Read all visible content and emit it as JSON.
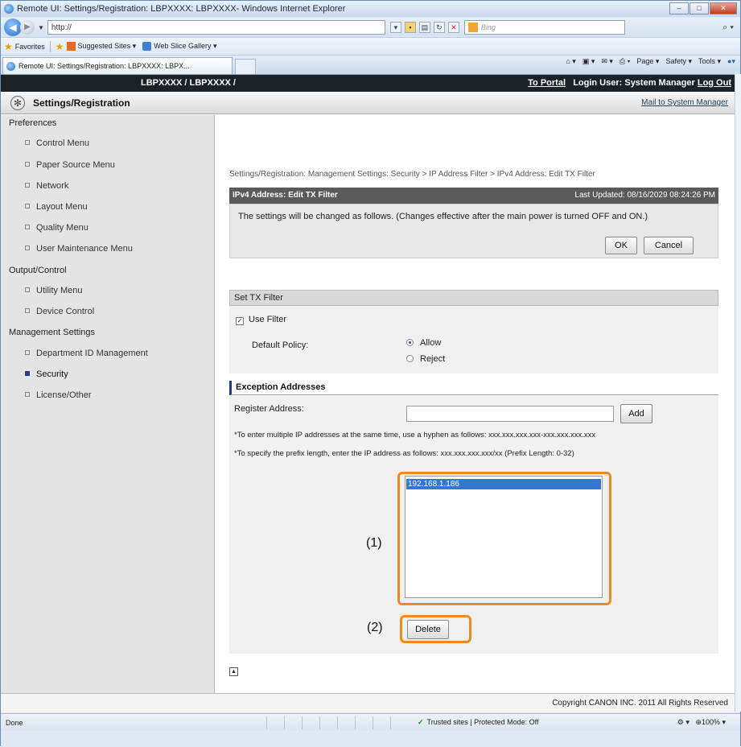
{
  "window": {
    "title": "Remote UI: Settings/Registration: LBPXXXX: LBPXXXX- Windows Internet Explorer"
  },
  "browser": {
    "url": "http://",
    "search_placeholder": "Bing",
    "favorites": {
      "label": "Favorites",
      "items": [
        "Suggested Sites ▾",
        "Web Slice Gallery ▾"
      ]
    },
    "tab_title": "Remote UI: Settings/Registration: LBPXXXX: LBPX...",
    "commands": [
      "Page ▾",
      "Safety ▾",
      "Tools ▾"
    ],
    "status": {
      "left": "Done",
      "zone": "Trusted sites | Protected Mode: Off",
      "zoom": "100%"
    }
  },
  "header": {
    "brand": "LBPXXXX / LBPXXXX /",
    "to_portal": "To Portal",
    "login_label": "Login User: System Manager",
    "logout": "Log Out",
    "page_title": "Settings/Registration",
    "mail_link": "Mail to System Manager"
  },
  "sidebar": {
    "preferences": "Preferences",
    "pref_items": [
      "Control Menu",
      "Paper Source Menu",
      "Network",
      "Layout Menu",
      "Quality Menu",
      "User Maintenance Menu"
    ],
    "output": "Output/Control",
    "output_items": [
      "Utility Menu",
      "Device Control"
    ],
    "management": "Management Settings",
    "mgmt_items": [
      "Department ID Management",
      "Security",
      "License/Other"
    ]
  },
  "main": {
    "breadcrumb": "Settings/Registration: Management Settings: Security > IP Address Filter > IPv4 Address: Edit TX Filter",
    "section_title": "IPv4 Address: Edit TX Filter",
    "last_updated": "Last Updated: 08/16/2029 08:24:26 PM",
    "message": "The settings will be changed as follows. (Changes effective after the main power is turned OFF and ON.)",
    "ok": "OK",
    "cancel": "Cancel",
    "set_tx_filter": "Set TX Filter",
    "use_filter": "Use Filter",
    "default_policy": "Default Policy:",
    "allow": "Allow",
    "reject": "Reject",
    "exception_addresses": "Exception Addresses",
    "register_address": "Register Address:",
    "add": "Add",
    "note1": "*To enter multiple IP addresses at the same time, use a hyphen as follows: xxx.xxx.xxx.xxx-xxx.xxx.xxx.xxx",
    "note2": "*To specify the prefix length, enter the IP address as follows: xxx.xxx.xxx.xxx/xx (Prefix Length: 0-32)",
    "address_list": [
      "192.168.1.186"
    ],
    "delete": "Delete",
    "callout1": "(1)",
    "callout2": "(2)"
  },
  "footer": {
    "copyright": "Copyright CANON INC. 2011 All Rights Reserved"
  },
  "colors": {
    "highlight": "#f08a1e",
    "selected": "#3278d2",
    "header": "#1d2227"
  }
}
